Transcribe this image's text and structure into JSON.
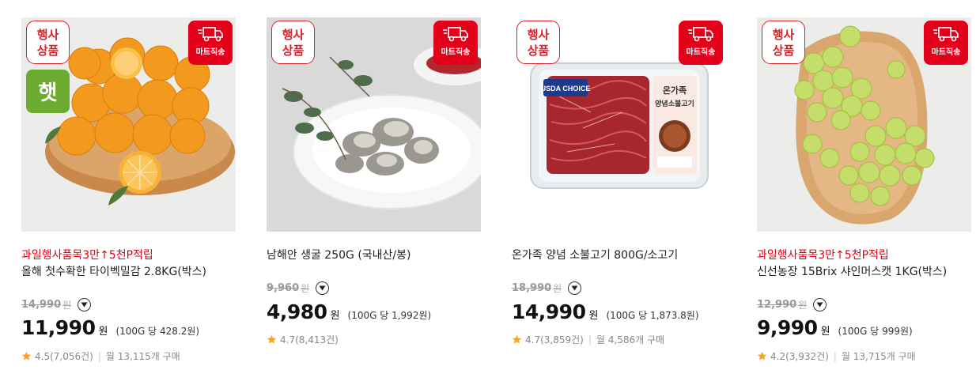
{
  "badges": {
    "event": [
      "행사",
      "상품"
    ],
    "delivery": "마트직송",
    "fresh": "햇"
  },
  "products": [
    {
      "promo": "과일행사품목3만↑5천P적립",
      "title": "올해 첫수확한 타이벡밀감 2.8KG(박스)",
      "original_price": "14,990",
      "original_unit": "원",
      "price": "11,990",
      "price_unit": "원",
      "unit_price": "(100G 당 428.2원)",
      "rating": "4.5",
      "reviews": "(7,056건)",
      "monthly": "월 13,115개 구매"
    },
    {
      "promo": "",
      "title": "남해안 생굴 250G (국내산/봉)",
      "original_price": "9,960",
      "original_unit": "원",
      "price": "4,980",
      "price_unit": "원",
      "unit_price": "(100G 당 1,992원)",
      "rating": "4.7",
      "reviews": "(8,413건)",
      "monthly": ""
    },
    {
      "promo": "",
      "title": "온가족 양념 소불고기 800G/소고기",
      "original_price": "18,990",
      "original_unit": "원",
      "price": "14,990",
      "price_unit": "원",
      "unit_price": "(100G 당 1,873.8원)",
      "rating": "4.7",
      "reviews": "(3,859건)",
      "monthly": "월 4,586개 구매"
    },
    {
      "promo": "과일행사품목3만↑5천P적립",
      "title": "신선농장 15Brix 샤인머스캣 1KG(박스)",
      "original_price": "12,990",
      "original_unit": "원",
      "price": "9,990",
      "price_unit": "원",
      "unit_price": "(100G 당 999원)",
      "rating": "4.2",
      "reviews": "(3,932건)",
      "monthly": "월 13,715개 구매"
    }
  ],
  "package_label": {
    "line1": "온가족",
    "line2": "양념소불고기",
    "brand": "USDA CHOICE"
  },
  "colors": {
    "accent_red": "#e60012",
    "badge_green": "#6bab2f",
    "star": "#f5a623"
  },
  "icons": [
    "delivery-truck-icon",
    "chevron-down-icon",
    "star-icon"
  ]
}
